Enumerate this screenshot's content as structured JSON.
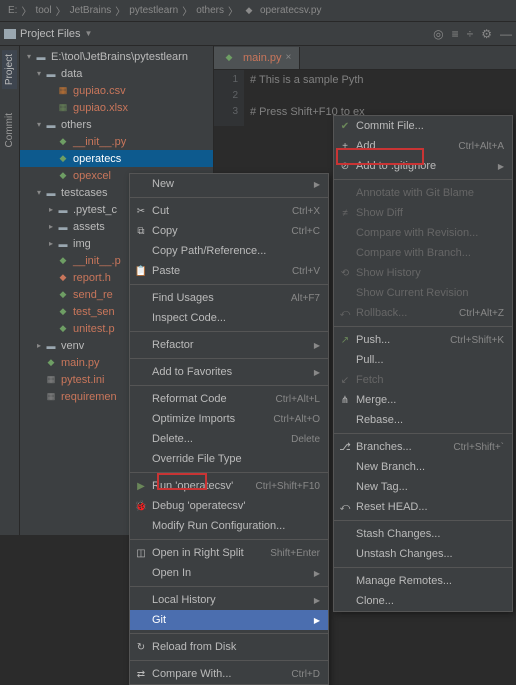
{
  "breadcrumb": {
    "root": "E:",
    "p1": "tool",
    "p2": "JetBrains",
    "p3": "pytestlearn",
    "p4": "others",
    "file": "operatecsv.py"
  },
  "toolbar": {
    "label": "Project Files"
  },
  "vtabs": {
    "project": "Project",
    "commit": "Commit"
  },
  "tree": {
    "root": "E:\\tool\\JetBrains\\pytestlearn",
    "data": "data",
    "gupiao_csv": "gupiao.csv",
    "gupiao_xlsx": "gupiao.xlsx",
    "others": "others",
    "init_py": "__init__.py",
    "operatecsv": "operatecs",
    "opexcel": "opexcel",
    "testcases": "testcases",
    "pytest_c": ".pytest_c",
    "assets": "assets",
    "img": "img",
    "init_p": "__init__.p",
    "report_h": "report.h",
    "send_re": "send_re",
    "test_sen": "test_sen",
    "unitest_p": "unitest.p",
    "venv": "venv",
    "main_py": "main.py",
    "pytest_ini": "pytest.ini",
    "requirements": "requiremen"
  },
  "editor": {
    "tab": "main.py",
    "gutter": [
      "1",
      "2",
      "3"
    ],
    "line1": "# This is a sample Pyth",
    "line2": "",
    "line3": "# Press Shift+F10 to ex"
  },
  "menu1": {
    "new": "New",
    "cut": "Cut",
    "cut_sc": "Ctrl+X",
    "copy": "Copy",
    "copy_sc": "Ctrl+C",
    "copy_path": "Copy Path/Reference...",
    "paste": "Paste",
    "paste_sc": "Ctrl+V",
    "find_usages": "Find Usages",
    "find_sc": "Alt+F7",
    "inspect": "Inspect Code...",
    "refactor": "Refactor",
    "add_fav": "Add to Favorites",
    "reformat": "Reformat Code",
    "reformat_sc": "Ctrl+Alt+L",
    "optimize": "Optimize Imports",
    "optimize_sc": "Ctrl+Alt+O",
    "delete": "Delete...",
    "delete_sc": "Delete",
    "override": "Override File Type",
    "run": "Run 'operatecsv'",
    "run_sc": "Ctrl+Shift+F10",
    "debug": "Debug 'operatecsv'",
    "modify_run": "Modify Run Configuration...",
    "open_split": "Open in Right Split",
    "split_sc": "Shift+Enter",
    "open_in": "Open In",
    "local_hist": "Local History",
    "git": "Git",
    "reload": "Reload from Disk",
    "compare": "Compare With...",
    "compare_sc": "Ctrl+D"
  },
  "menu2": {
    "commit_file": "Commit File...",
    "add": "Add",
    "add_sc": "Ctrl+Alt+A",
    "gitignore": "Add to .gitignore",
    "annotate": "Annotate with Git Blame",
    "show_diff": "Show Diff",
    "compare_rev": "Compare with Revision...",
    "compare_branch": "Compare with Branch...",
    "show_hist": "Show History",
    "show_cur": "Show Current Revision",
    "rollback": "Rollback...",
    "rollback_sc": "Ctrl+Alt+Z",
    "push": "Push...",
    "push_sc": "Ctrl+Shift+K",
    "pull": "Pull...",
    "fetch": "Fetch",
    "merge": "Merge...",
    "rebase": "Rebase...",
    "branches": "Branches...",
    "branches_sc": "Ctrl+Shift+`",
    "new_branch": "New Branch...",
    "new_tag": "New Tag...",
    "reset_head": "Reset HEAD...",
    "stash": "Stash Changes...",
    "unstash": "Unstash Changes...",
    "manage_remotes": "Manage Remotes...",
    "clone": "Clone..."
  }
}
